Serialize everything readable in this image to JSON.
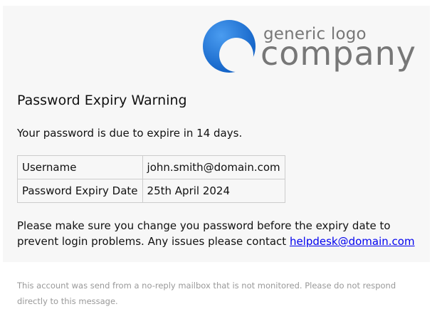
{
  "logo": {
    "line1": "generic logo",
    "line2": "company",
    "circle_color": "#1a73d8",
    "text_color": "#777777"
  },
  "heading": "Password Expiry Warning",
  "intro": "Your password is due to expire in 14 days.",
  "details": [
    {
      "label": "Username",
      "value": "john.smith@domain.com"
    },
    {
      "label": "Password Expiry Date",
      "value": "25th April 2024"
    }
  ],
  "warning": {
    "text": "Please make sure you change you password before the expiry date to prevent login problems. Any issues please contact ",
    "link_text": "helpdesk@domain.com",
    "link_color": "#0000ee"
  },
  "footer": "This account was send from a no-reply mailbox that is not monitored. Please do not respond directly to this message."
}
